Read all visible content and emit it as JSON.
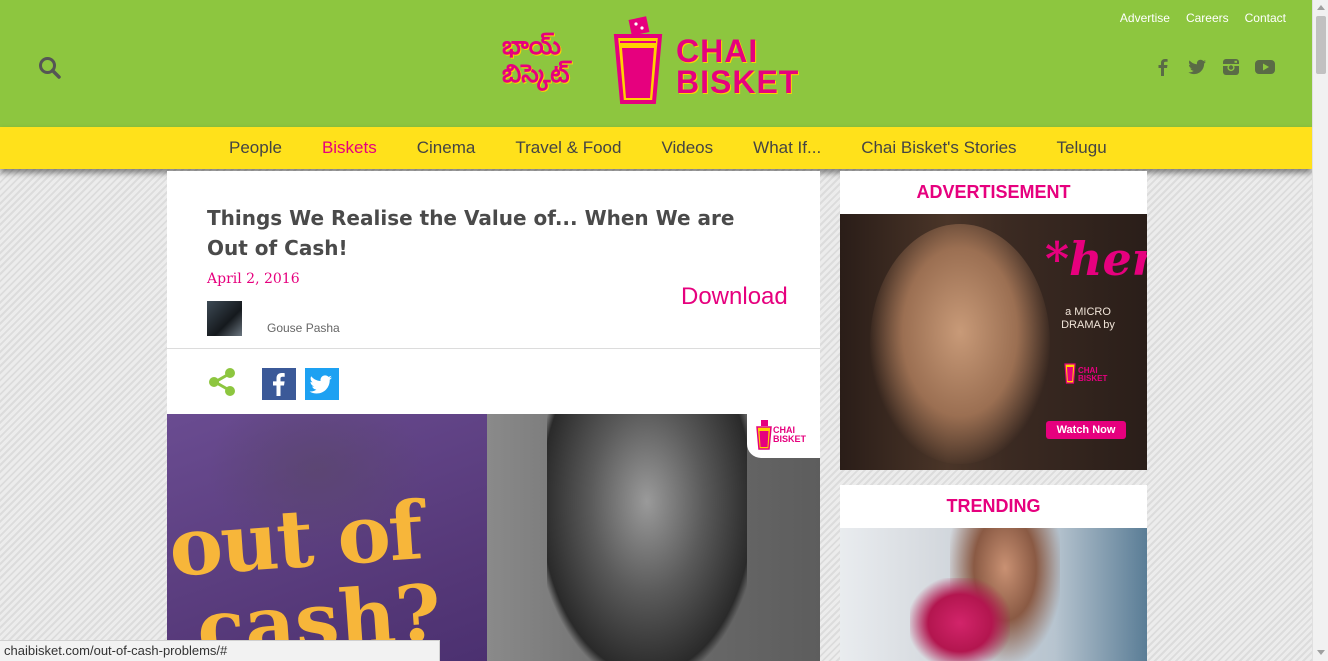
{
  "header": {
    "logo_telugu": "భాయ్ బిస్కెట్",
    "logo_english": "CHAI BISKET",
    "top_links": [
      "Advertise",
      "Careers",
      "Contact"
    ],
    "search_icon": "search-icon",
    "social_icons": [
      "facebook-icon",
      "twitter-icon",
      "instagram-icon",
      "youtube-icon"
    ],
    "brand_color": "#8dc63f",
    "accent_color": "#e6007e"
  },
  "nav": {
    "items": [
      "People",
      "Biskets",
      "Cinema",
      "Travel & Food",
      "Videos",
      "What If...",
      "Chai Bisket's Stories",
      "Telugu"
    ],
    "active": "Biskets",
    "bar_color": "#ffe11b"
  },
  "article": {
    "title": "Things We Realise the Value of... When We are Out of Cash!",
    "date": "April 2, 2016",
    "author": "Gouse Pasha",
    "download_label": "Download",
    "hero_text_line1": "out of",
    "hero_text_line2": "cash?",
    "hero_badge": "CHAI BISKET"
  },
  "sidebar": {
    "ad_heading": "ADVERTISEMENT",
    "ad_title": "*her",
    "ad_subtitle": "a MICRO DRAMA by",
    "ad_logo": "CHAI BISKET",
    "ad_cta": "Watch Now",
    "trending_heading": "TRENDING"
  },
  "statusbar": {
    "url": "chaibisket.com/out-of-cash-problems/#"
  }
}
